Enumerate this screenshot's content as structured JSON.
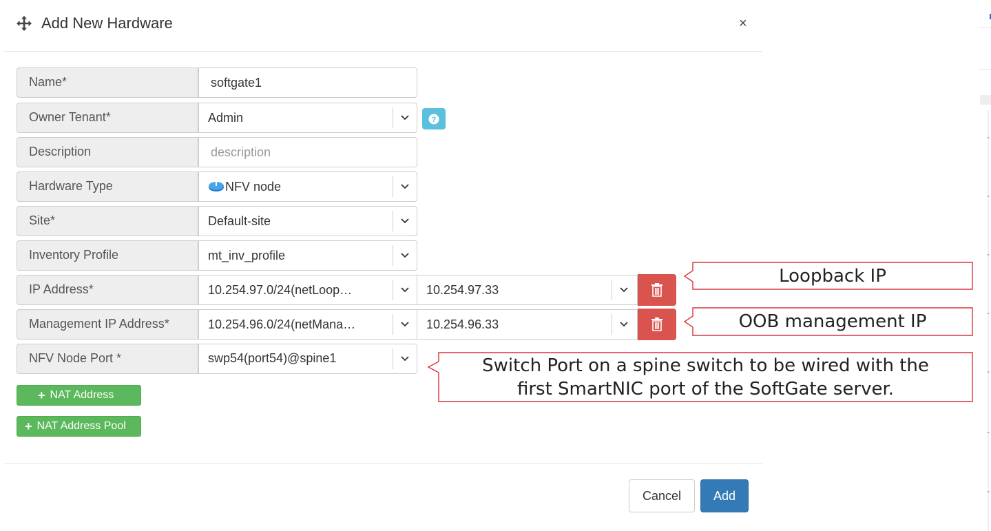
{
  "dialog": {
    "title": "Add New Hardware",
    "close_label": "×",
    "move_icon": "move-arrows-icon"
  },
  "form": {
    "name": {
      "label": "Name*",
      "value": "softgate1"
    },
    "owner_tenant": {
      "label": "Owner Tenant*",
      "value": "Admin",
      "help_icon": "question-circle-icon"
    },
    "description": {
      "label": "Description",
      "placeholder": "description"
    },
    "hardware_type": {
      "label": "Hardware Type",
      "value": "NFV node",
      "icon": "nfv-node-icon"
    },
    "site": {
      "label": "Site*",
      "value": "Default-site"
    },
    "inventory_profile": {
      "label": "Inventory Profile",
      "value": "mt_inv_profile"
    },
    "ip_address": {
      "label": "IP Address*",
      "network": "10.254.97.0/24(netLoop…",
      "address": "10.254.97.33"
    },
    "management_ip_address": {
      "label": "Management IP Address*",
      "network": "10.254.96.0/24(netMana…",
      "address": "10.254.96.33"
    },
    "nfv_node_port": {
      "label": "NFV Node Port *",
      "value": "swp54(port54)@spine1"
    }
  },
  "actions": {
    "nat_address": "NAT Address",
    "nat_address_pool": "NAT Address Pool",
    "cancel": "Cancel",
    "add": "Add"
  },
  "annotations": {
    "loopback": "Loopback IP",
    "oob": "OOB management IP",
    "switch_port_line1": "Switch Port on a spine switch to be wired with the",
    "switch_port_line2": "first SmartNIC port of the SoftGate server."
  },
  "colors": {
    "success": "#5cb85c",
    "danger": "#d9534f",
    "primary": "#337ab7",
    "info": "#5bc0de",
    "callout_border": "#d9343c"
  }
}
